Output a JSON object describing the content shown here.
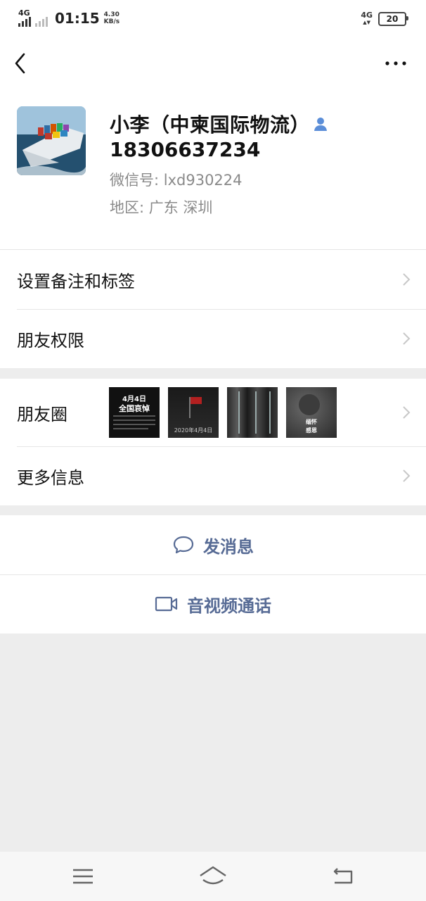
{
  "status_bar": {
    "sim1_label": "4G",
    "time": "01:15",
    "speed_value": "4.30",
    "speed_unit": "KB/s",
    "network_label": "4G",
    "battery_level": "20"
  },
  "nav": {
    "back_icon": "chevron-left-icon",
    "more_icon": "more-dots-icon"
  },
  "profile": {
    "name": "小李（中柬国际物流）",
    "phone": "18306637234",
    "wechat_id": "微信号: lxd930224",
    "region": "地区: 广东  深圳",
    "avatar_icon": "cargo-ship-photo",
    "contact_icon": "contact-person-icon"
  },
  "menu": {
    "set_remark": "设置备注和标签",
    "friend_permissions": "朋友权限",
    "moments": "朋友圈",
    "more_info": "更多信息"
  },
  "moments_thumbs": [
    {
      "title": "4月4日",
      "subtitle": "全国哀悼"
    },
    {
      "caption": "2020年4月4日"
    },
    {
      "caption": ""
    },
    {
      "title": "缅怀",
      "subtitle": "感恩"
    }
  ],
  "actions": {
    "send_message": "发消息",
    "video_call": "音视频通话"
  },
  "colors": {
    "accent": "#576b95",
    "background": "#ededed",
    "secondary_text": "#8a8a8a"
  }
}
